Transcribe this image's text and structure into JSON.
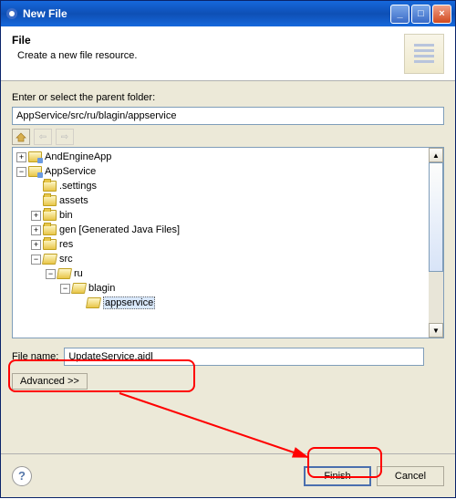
{
  "titlebar": {
    "title": "New File"
  },
  "banner": {
    "title": "File",
    "desc": "Create a new file resource."
  },
  "parent_label": "Enter or select the parent folder:",
  "parent_path": "AppService/src/ru/blagin/appservice",
  "tree": {
    "items": [
      {
        "indent": 0,
        "exp": "+",
        "icon": "proj",
        "label": "AndEngineApp"
      },
      {
        "indent": 0,
        "exp": "-",
        "icon": "proj",
        "label": "AppService"
      },
      {
        "indent": 1,
        "exp": "",
        "icon": "closed",
        "label": ".settings"
      },
      {
        "indent": 1,
        "exp": "",
        "icon": "closed",
        "label": "assets"
      },
      {
        "indent": 1,
        "exp": "+",
        "icon": "closed",
        "label": "bin"
      },
      {
        "indent": 1,
        "exp": "+",
        "icon": "closed",
        "label": "gen [Generated Java Files]"
      },
      {
        "indent": 1,
        "exp": "+",
        "icon": "closed",
        "label": "res"
      },
      {
        "indent": 1,
        "exp": "-",
        "icon": "open",
        "label": "src"
      },
      {
        "indent": 2,
        "exp": "-",
        "icon": "open",
        "label": "ru"
      },
      {
        "indent": 3,
        "exp": "-",
        "icon": "open",
        "label": "blagin"
      },
      {
        "indent": 4,
        "exp": "",
        "icon": "open",
        "label": "appservice",
        "selected": true
      }
    ]
  },
  "filename_label": "File name:",
  "filename_value": "UpdateService.aidl",
  "advanced_label": "Advanced >>",
  "buttons": {
    "finish": "Finish",
    "cancel": "Cancel"
  }
}
